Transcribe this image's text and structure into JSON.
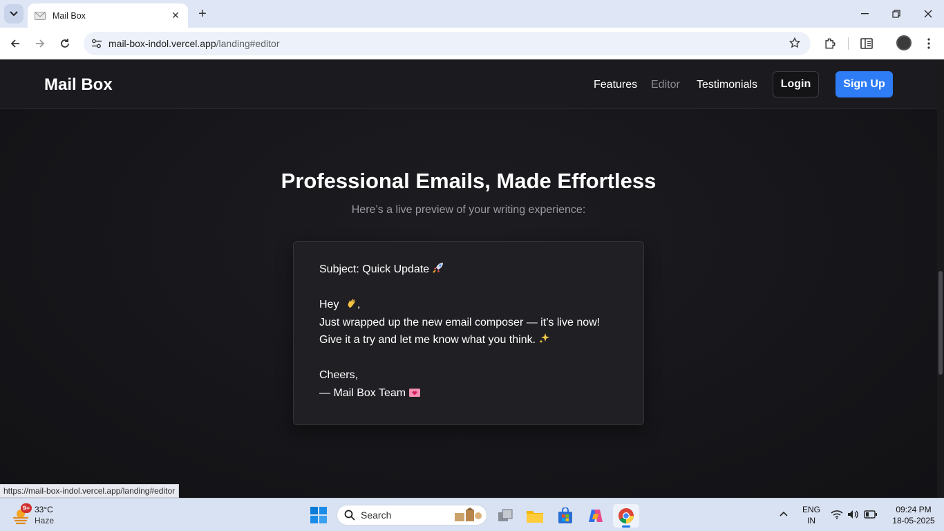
{
  "browser": {
    "tab_title": "Mail Box",
    "url_host": "mail-box-indol.vercel.app",
    "url_path": "/landing#editor",
    "status_url": "https://mail-box-indol.vercel.app/landing#editor"
  },
  "header": {
    "brand": "Mail Box",
    "nav": [
      {
        "label": "Features"
      },
      {
        "label": "Editor"
      },
      {
        "label": "Testimonials"
      }
    ],
    "login": "Login",
    "signup": "Sign Up"
  },
  "hero": {
    "title": "Professional Emails, Made Effortless",
    "subtitle": "Here’s a live preview of your writing experience:"
  },
  "email": {
    "subject": "Subject: Quick Update",
    "greeting": "Hey",
    "body_1": "Just wrapped up the new email composer — it’s live now!",
    "body_2": "Give it a try and let me know what you think.",
    "signoff": "Cheers,",
    "signature": "— Mail Box Team"
  },
  "taskbar": {
    "weather_temp": "33°C",
    "weather_cond": "Haze",
    "weather_badge": "9+",
    "search_label": "Search",
    "lang": "ENG",
    "region": "IN",
    "time": "09:24 PM",
    "date": "18-05-2025"
  },
  "colors": {
    "accent": "#2e7cf6",
    "page_bg": "#16161a",
    "card_bg": "#202024"
  }
}
